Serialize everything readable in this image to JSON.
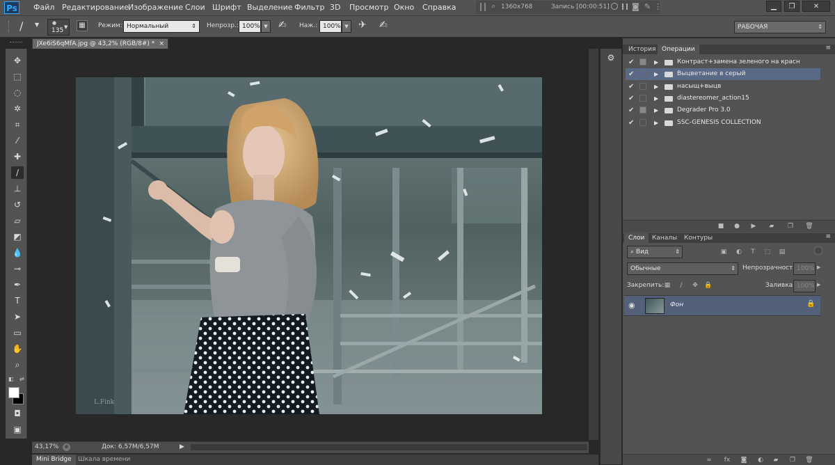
{
  "app": {
    "logo": "Ps"
  },
  "menu": [
    "Файл",
    "Редактирование",
    "Изображение",
    "Слои",
    "Шрифт",
    "Выделение",
    "Фильтр",
    "3D",
    "Просмотр",
    "Окно",
    "Справка"
  ],
  "recorder": {
    "resolution": "1360x768",
    "status": "Запись [00:00:51]"
  },
  "window_controls": {
    "minimize": "▁",
    "restore": "❐",
    "close": "✕"
  },
  "options": {
    "brush_size": "135",
    "mode_label": "Режим:",
    "mode_value": "Нормальный",
    "opacity_label": "Непрозр.:",
    "opacity_value": "100%",
    "flow_label": "Наж.:",
    "flow_value": "100%",
    "workspace": "РАБОЧАЯ"
  },
  "document": {
    "tab_title": "JXe6iS6qMfA.jpg @ 43,2% (RGB/8#) *",
    "close": "×",
    "zoom": "43,17%",
    "doc_info": "Док: 6,57M/6,57M",
    "watermark": "L.Fink"
  },
  "bottom_tabs": [
    "Mini Bridge",
    "Шкала времени"
  ],
  "history_panel": {
    "tabs": [
      "История",
      "Операции"
    ],
    "actions": [
      {
        "name": "Контраст+замена зеленого на красн",
        "selected": false
      },
      {
        "name": "Выцветание в серый",
        "selected": true
      },
      {
        "name": "насыщ+выцв",
        "selected": false
      },
      {
        "name": "diastereomer_action15",
        "selected": false
      },
      {
        "name": "Degrader Pro 3.0",
        "selected": false
      },
      {
        "name": "SSC-GENESIS COLLECTION",
        "selected": false
      }
    ]
  },
  "layers_panel": {
    "tabs": [
      "Слои",
      "Каналы",
      "Контуры"
    ],
    "filter_label": "Вид",
    "blend_mode": "Обычные",
    "opacity_label": "Непрозрачность:",
    "opacity_value": "100%",
    "lock_label": "Закрепить:",
    "fill_label": "Заливка:",
    "fill_value": "100%",
    "layers": [
      {
        "name": "Фон",
        "locked": true
      }
    ]
  },
  "colors": {
    "accent": "#31a8ff",
    "selection": "#5a6a86",
    "layer_selected": "#52607a"
  }
}
